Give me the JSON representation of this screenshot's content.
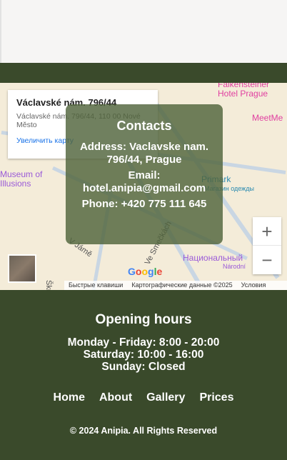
{
  "map": {
    "info_title": "Václavské nám. 796/44",
    "info_address": "Václavské nám. 796/44, 110 00 Nové Město",
    "info_link": "Увеличить карту",
    "places": [
      "Falkensteiner Hotel Prague",
      "MeetMe",
      "Museum of Illusions",
      "Primark",
      "Магазин одежды",
      "Национальный",
      "Národní",
      "V Jámě",
      "Ve Smečkách",
      "Škrétova"
    ],
    "zoom_in": "+",
    "zoom_out": "−",
    "google": "Google",
    "attribution": [
      "Быстрые клавиши",
      "Картографические данные ©2025",
      "Условия"
    ]
  },
  "contacts": {
    "title": "Contacts",
    "address": "Address: Vaclavske nam. 796/44, Prague",
    "email": "Email: hotel.anipia@gmail.com",
    "phone": "Phone: +420 775 111 645"
  },
  "footer": {
    "hours_title": "Opening hours",
    "hours": [
      "Monday - Friday: 8:00 - 20:00",
      "Saturday: 10:00 - 16:00",
      "Sunday: Closed"
    ],
    "nav": [
      "Home",
      "About",
      "Gallery",
      "Prices"
    ],
    "copyright": "© 2024 Anipia. All Rights Reserved"
  },
  "colors": {
    "brand": "#3a4a2b",
    "overlay": "#50643c"
  }
}
